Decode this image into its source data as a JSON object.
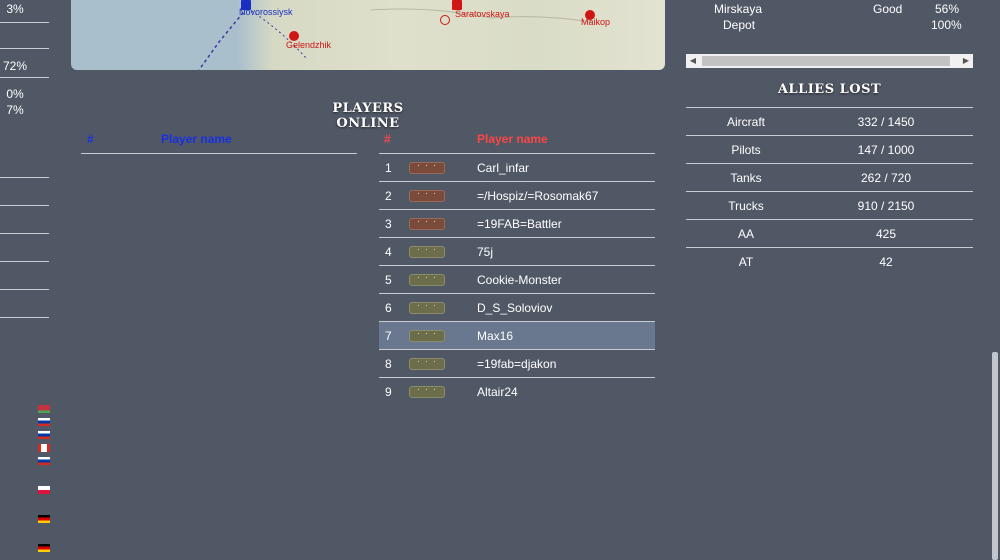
{
  "left_panel": {
    "values": [
      "3%",
      "72%",
      "0%",
      "7%"
    ]
  },
  "map": {
    "cities": [
      {
        "name": "Novorossiysk",
        "color": "blue"
      },
      {
        "name": "Gelendzhik",
        "color": "red"
      },
      {
        "name": "Saratovskaya",
        "color": "red"
      },
      {
        "name": "Maikop",
        "color": "red"
      }
    ]
  },
  "right_top": {
    "rows": [
      {
        "name": "Mirskaya",
        "status": "Good",
        "value": "56%"
      },
      {
        "name": "Depot",
        "status": "",
        "value": "100%"
      }
    ]
  },
  "players_online": {
    "title": "Players online",
    "blue_table": {
      "num_header": "#",
      "name_header": "Player name",
      "header_color": "#1a2fe0"
    },
    "red_table": {
      "num_header": "#",
      "name_header": "Player name",
      "header_color": "#ff4444",
      "rows": [
        {
          "num": "1",
          "name": "Carl_infar",
          "rank": "red"
        },
        {
          "num": "2",
          "name": "=/Hospiz/=Rosomak67",
          "rank": "red"
        },
        {
          "num": "3",
          "name": "=19FAB=Battler",
          "rank": "red"
        },
        {
          "num": "4",
          "name": "75j",
          "rank": "green"
        },
        {
          "num": "5",
          "name": "Cookie-Monster",
          "rank": "green"
        },
        {
          "num": "6",
          "name": "D_S_Soloviov",
          "rank": "green"
        },
        {
          "num": "7",
          "name": "Max16",
          "rank": "green",
          "selected": true
        },
        {
          "num": "8",
          "name": "=19fab=djakon",
          "rank": "green"
        },
        {
          "num": "9",
          "name": "Altair24",
          "rank": "green"
        }
      ]
    }
  },
  "allies_lost": {
    "title": "Allies lost",
    "rows": [
      {
        "label": "Aircraft",
        "value": "332 / 1450"
      },
      {
        "label": "Pilots",
        "value": "147 / 1000"
      },
      {
        "label": "Tanks",
        "value": "262 / 720"
      },
      {
        "label": "Trucks",
        "value": "910 / 2150"
      },
      {
        "label": "AA",
        "value": "425"
      },
      {
        "label": "AT",
        "value": "42"
      }
    ]
  },
  "flags": [
    "belarus",
    "russia",
    "russia",
    "canada",
    "russia",
    "poland",
    "germany",
    "germany"
  ]
}
